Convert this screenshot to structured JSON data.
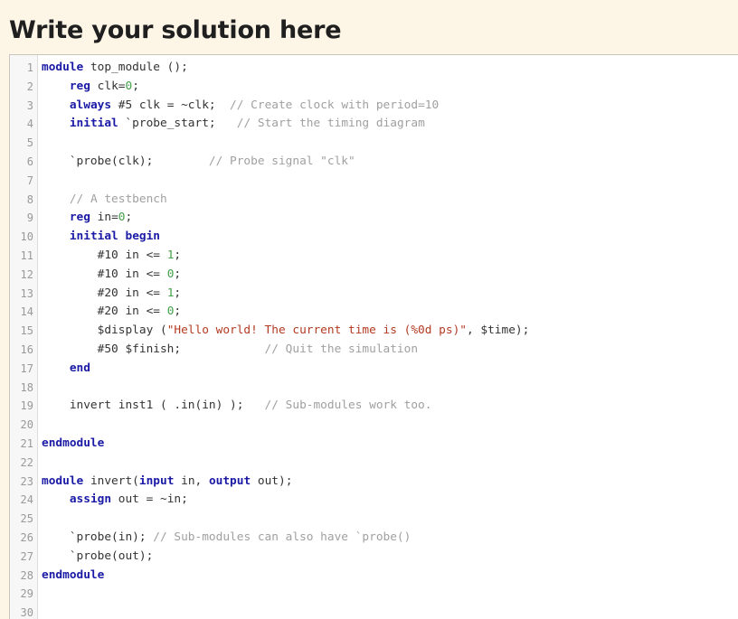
{
  "page": {
    "heading": "Write your solution here"
  },
  "editor": {
    "lines": [
      {
        "num": "1",
        "tokens": [
          [
            "k",
            "module"
          ],
          [
            "p",
            " top_module ();"
          ]
        ]
      },
      {
        "num": "2",
        "tokens": [
          [
            "p",
            "    "
          ],
          [
            "k",
            "reg"
          ],
          [
            "p",
            " clk="
          ],
          [
            "n",
            "0"
          ],
          [
            "p",
            ";"
          ]
        ]
      },
      {
        "num": "3",
        "tokens": [
          [
            "p",
            "    "
          ],
          [
            "k",
            "always"
          ],
          [
            "p",
            " #5 clk = ~clk;  "
          ],
          [
            "c",
            "// Create clock with period=10"
          ]
        ]
      },
      {
        "num": "4",
        "tokens": [
          [
            "p",
            "    "
          ],
          [
            "k",
            "initial"
          ],
          [
            "p",
            " `probe_start;   "
          ],
          [
            "c",
            "// Start the timing diagram"
          ]
        ]
      },
      {
        "num": "5",
        "tokens": []
      },
      {
        "num": "6",
        "tokens": [
          [
            "p",
            "    `probe(clk);        "
          ],
          [
            "c",
            "// Probe signal \"clk\""
          ]
        ]
      },
      {
        "num": "7",
        "tokens": []
      },
      {
        "num": "8",
        "tokens": [
          [
            "p",
            "    "
          ],
          [
            "c",
            "// A testbench"
          ]
        ]
      },
      {
        "num": "9",
        "tokens": [
          [
            "p",
            "    "
          ],
          [
            "k",
            "reg"
          ],
          [
            "p",
            " in="
          ],
          [
            "n",
            "0"
          ],
          [
            "p",
            ";"
          ]
        ]
      },
      {
        "num": "10",
        "tokens": [
          [
            "p",
            "    "
          ],
          [
            "k",
            "initial"
          ],
          [
            "p",
            " "
          ],
          [
            "k",
            "begin"
          ]
        ]
      },
      {
        "num": "11",
        "tokens": [
          [
            "p",
            "        #10 in <= "
          ],
          [
            "n",
            "1"
          ],
          [
            "p",
            ";"
          ]
        ]
      },
      {
        "num": "12",
        "tokens": [
          [
            "p",
            "        #10 in <= "
          ],
          [
            "n",
            "0"
          ],
          [
            "p",
            ";"
          ]
        ]
      },
      {
        "num": "13",
        "tokens": [
          [
            "p",
            "        #20 in <= "
          ],
          [
            "n",
            "1"
          ],
          [
            "p",
            ";"
          ]
        ]
      },
      {
        "num": "14",
        "tokens": [
          [
            "p",
            "        #20 in <= "
          ],
          [
            "n",
            "0"
          ],
          [
            "p",
            ";"
          ]
        ]
      },
      {
        "num": "15",
        "tokens": [
          [
            "p",
            "        $display ("
          ],
          [
            "s",
            "\"Hello world! The current time is (%0d ps)\""
          ],
          [
            "p",
            ", $time);"
          ]
        ]
      },
      {
        "num": "16",
        "tokens": [
          [
            "p",
            "        #50 $finish;            "
          ],
          [
            "c",
            "// Quit the simulation"
          ]
        ]
      },
      {
        "num": "17",
        "tokens": [
          [
            "p",
            "    "
          ],
          [
            "k",
            "end"
          ]
        ]
      },
      {
        "num": "18",
        "tokens": []
      },
      {
        "num": "19",
        "tokens": [
          [
            "p",
            "    invert inst1 ( .in(in) );   "
          ],
          [
            "c",
            "// Sub-modules work too."
          ]
        ]
      },
      {
        "num": "20",
        "tokens": []
      },
      {
        "num": "21",
        "tokens": [
          [
            "k",
            "endmodule"
          ]
        ]
      },
      {
        "num": "22",
        "tokens": []
      },
      {
        "num": "23",
        "tokens": [
          [
            "k",
            "module"
          ],
          [
            "p",
            " invert("
          ],
          [
            "k",
            "input"
          ],
          [
            "p",
            " in, "
          ],
          [
            "k",
            "output"
          ],
          [
            "p",
            " out);"
          ]
        ]
      },
      {
        "num": "24",
        "tokens": [
          [
            "p",
            "    "
          ],
          [
            "k",
            "assign"
          ],
          [
            "p",
            " out = ~in;"
          ]
        ]
      },
      {
        "num": "25",
        "tokens": []
      },
      {
        "num": "26",
        "tokens": [
          [
            "p",
            "    `probe(in); "
          ],
          [
            "c",
            "// Sub-modules can also have `probe()"
          ]
        ]
      },
      {
        "num": "27",
        "tokens": [
          [
            "p",
            "    `probe(out);"
          ]
        ]
      },
      {
        "num": "28",
        "tokens": [
          [
            "k",
            "endmodule"
          ]
        ]
      },
      {
        "num": "29",
        "tokens": []
      },
      {
        "num": "30",
        "tokens": []
      }
    ]
  }
}
